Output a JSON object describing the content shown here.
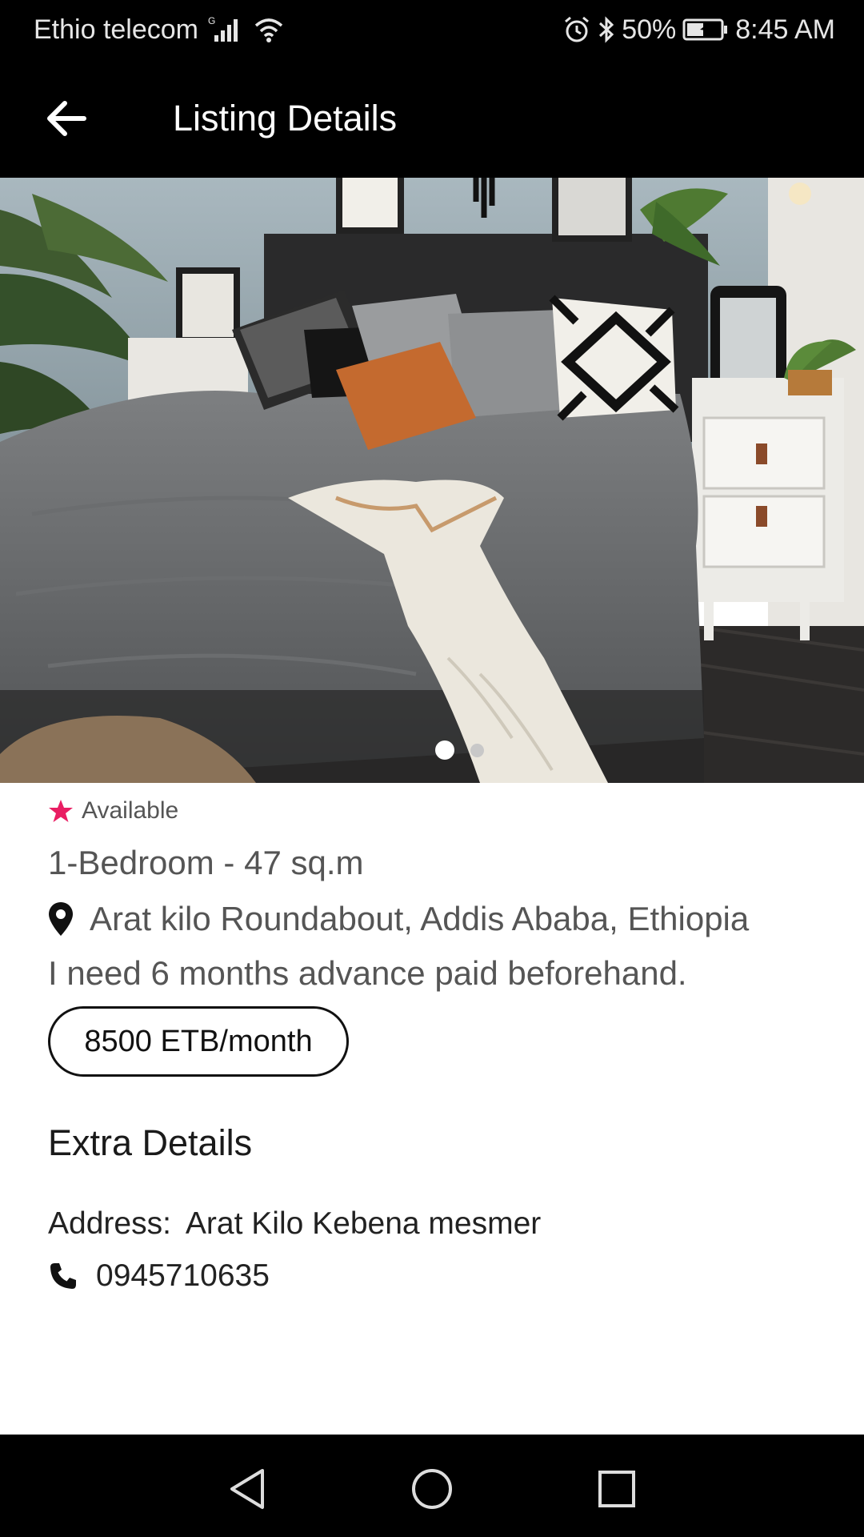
{
  "status_bar": {
    "carrier": "Ethio telecom",
    "network_type": "G",
    "battery": "50%",
    "time": "8:45 AM",
    "icons": [
      "signal-icon",
      "wifi-icon",
      "alarm-icon",
      "bluetooth-icon",
      "battery-icon"
    ]
  },
  "app_bar": {
    "title": "Listing Details",
    "back_icon": "arrow-back-icon"
  },
  "gallery": {
    "image_description": "bedroom-photo",
    "page_count": 2,
    "current_page": 1
  },
  "listing": {
    "status": "Available",
    "status_color": "#e91e63",
    "summary": "1-Bedroom - 47 sq.m",
    "location": "Arat kilo Roundabout, Addis Ababa, Ethiopia",
    "note": "I need 6 months advance paid beforehand.",
    "price": "8500 ETB/month"
  },
  "extra_details": {
    "title": "Extra Details",
    "address_label": "Address:",
    "address_value": "Arat Kilo Kebena mesmer",
    "phone": "0945710635"
  },
  "nav_bar": {
    "buttons": [
      "back-triangle-icon",
      "home-circle-icon",
      "recents-square-icon"
    ]
  }
}
